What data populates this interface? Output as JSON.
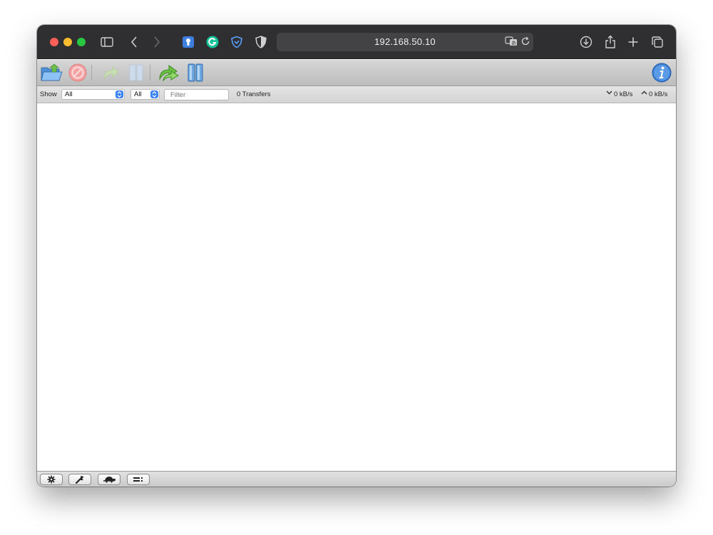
{
  "browser": {
    "url": "192.168.50.10",
    "icons": [
      "sidebar-icon",
      "back-icon",
      "forward-icon",
      "bitwarden-icon",
      "grammarly-icon",
      "privacy-shield-icon",
      "privacy-report-icon",
      "translate-icon",
      "reload-icon",
      "download-icon",
      "share-icon",
      "new-tab-icon",
      "tab-overview-icon"
    ]
  },
  "toolbar": {
    "buttons": [
      "open-torrent",
      "remove-torrent",
      "start-torrent",
      "pause-torrent",
      "start-all",
      "pause-all",
      "inspector"
    ]
  },
  "filterbar": {
    "show_label": "Show",
    "status_select": "All",
    "tracker_select": "All",
    "filter_placeholder": "Filter",
    "transfers_count": "0 Transfers",
    "download_speed": "0 kB/s",
    "upload_speed": "0 kB/s"
  },
  "statusbar": {
    "buttons": [
      "settings",
      "preferences",
      "turtle-mode",
      "compact-view"
    ]
  },
  "colors": {
    "titlebar": "#2f2f31",
    "urlbar": "#434345",
    "select_accent": "#3b82f6"
  }
}
